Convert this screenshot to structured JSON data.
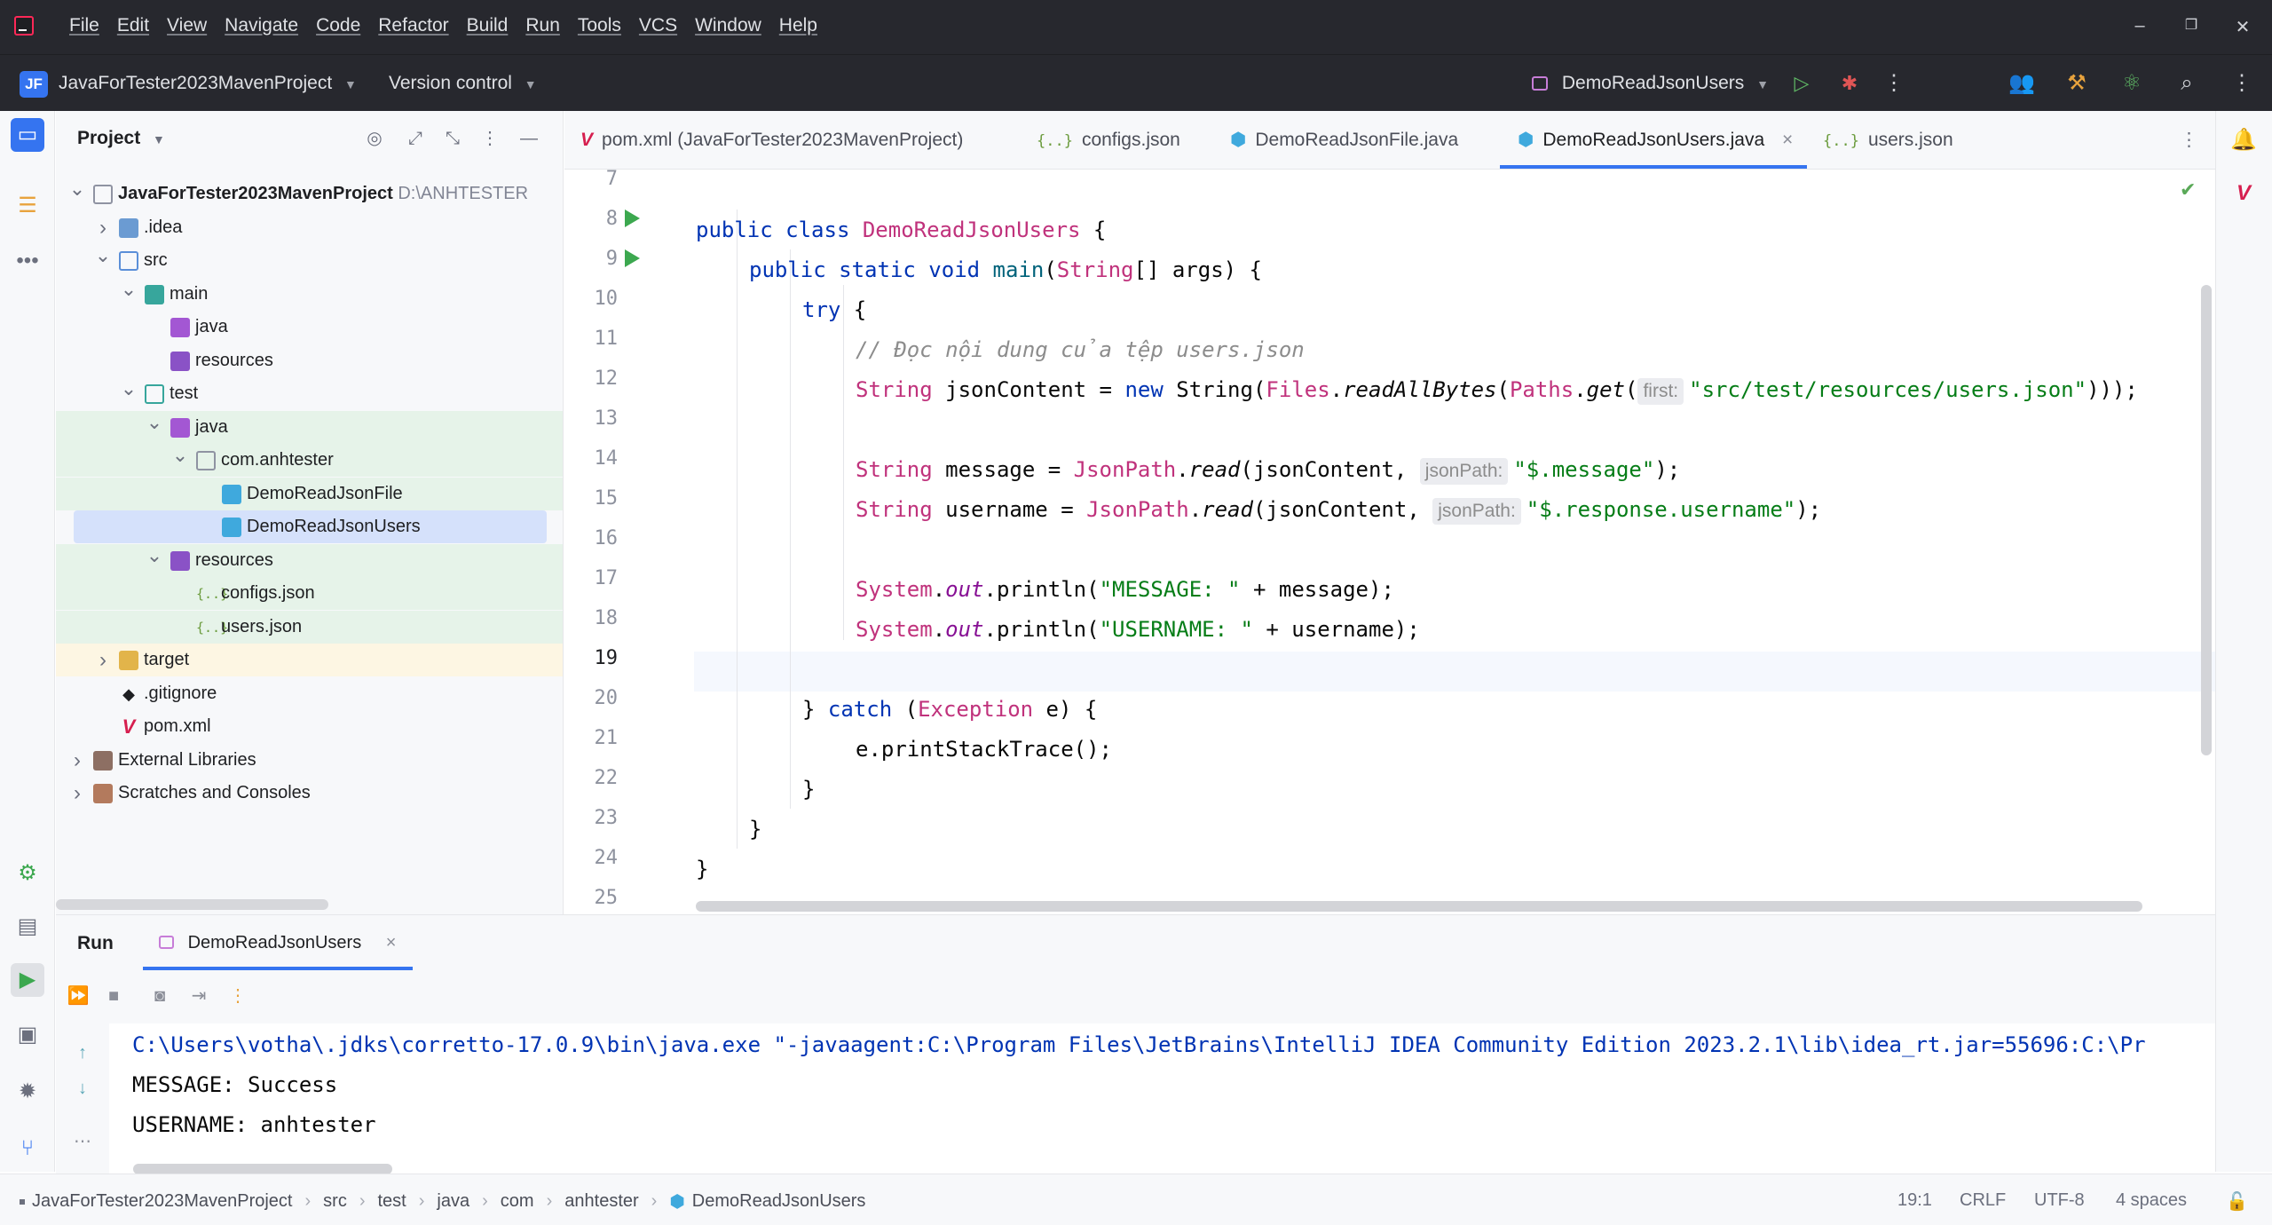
{
  "menu": [
    "File",
    "Edit",
    "View",
    "Navigate",
    "Code",
    "Refactor",
    "Build",
    "Run",
    "Tools",
    "VCS",
    "Window",
    "Help"
  ],
  "window_controls": {
    "minimize": "–",
    "restore": "❐",
    "close": "✕"
  },
  "toolbar": {
    "project_badge": "JF",
    "project_name": "JavaForTester2023MavenProject",
    "vcs_label": "Version control",
    "run_config": "DemoReadJsonUsers"
  },
  "icons": {
    "run": "play-icon",
    "debug": "bug-icon",
    "more": "more-vertical-icon",
    "collab": "people-icon",
    "build": "hammer-icon",
    "ai": "atom-icon",
    "search": "search-icon",
    "settings": "gear-icon"
  },
  "colors": {
    "accent": "#3574f0",
    "keyword": "#0033b3",
    "string": "#067d17",
    "class": "#c0327c",
    "run_green": "#3ca84f",
    "header_bg": "#27282e"
  },
  "project_panel": {
    "title": "Project",
    "tree": [
      {
        "label": "JavaForTester2023MavenProject",
        "extra": "D:\\ANHTESTER",
        "depth": 0,
        "chev": "open",
        "icon": "folder",
        "bold": true
      },
      {
        "label": ".idea",
        "depth": 1,
        "chev": "closed",
        "icon": "folder-blue"
      },
      {
        "label": "src",
        "depth": 1,
        "chev": "open",
        "icon": "src"
      },
      {
        "label": "main",
        "depth": 2,
        "chev": "open",
        "icon": "test"
      },
      {
        "label": "java",
        "depth": 3,
        "chev": "",
        "icon": "java"
      },
      {
        "label": "resources",
        "depth": 3,
        "chev": "",
        "icon": "res"
      },
      {
        "label": "test",
        "depth": 2,
        "chev": "open",
        "icon": "testsrc"
      },
      {
        "label": "java",
        "depth": 3,
        "chev": "open",
        "icon": "java",
        "hl": "green"
      },
      {
        "label": "com.anhtester",
        "depth": 4,
        "chev": "open",
        "icon": "folder",
        "hl": "green"
      },
      {
        "label": "DemoReadJsonFile",
        "depth": 5,
        "chev": "",
        "icon": "class",
        "hl": "green"
      },
      {
        "label": "DemoReadJsonUsers",
        "depth": 5,
        "chev": "",
        "icon": "class",
        "hl": "selected"
      },
      {
        "label": "resources",
        "depth": 3,
        "chev": "open",
        "icon": "res",
        "hl": "green"
      },
      {
        "label": "configs.json",
        "depth": 4,
        "chev": "",
        "icon": "json",
        "hl": "green"
      },
      {
        "label": "users.json",
        "depth": 4,
        "chev": "",
        "icon": "json",
        "hl": "green"
      },
      {
        "label": "target",
        "depth": 1,
        "chev": "closed",
        "icon": "target",
        "hl": "yellow"
      },
      {
        "label": ".gitignore",
        "depth": 1,
        "chev": "",
        "icon": "git"
      },
      {
        "label": "pom.xml",
        "depth": 1,
        "chev": "",
        "icon": "maven"
      },
      {
        "label": "External Libraries",
        "depth": 0,
        "chev": "closed",
        "icon": "lib"
      },
      {
        "label": "Scratches and Consoles",
        "depth": 0,
        "chev": "closed",
        "icon": "scratch"
      }
    ]
  },
  "editor": {
    "tabs": [
      {
        "label": "pom.xml (JavaForTester2023MavenProject)",
        "icon": "maven-icon"
      },
      {
        "label": "configs.json",
        "icon": "json-icon"
      },
      {
        "label": "DemoReadJsonFile.java",
        "icon": "class-icon"
      },
      {
        "label": "DemoReadJsonUsers.java",
        "icon": "class-icon",
        "active": true,
        "close": "×"
      },
      {
        "label": "users.json",
        "icon": "json-icon"
      }
    ],
    "line_numbers": [
      "7",
      "8",
      "9",
      "10",
      "11",
      "12",
      "13",
      "14",
      "15",
      "16",
      "17",
      "18",
      "19",
      "20",
      "21",
      "22",
      "23",
      "24",
      "25"
    ],
    "hints": {
      "first": "first:",
      "json_path": "jsonPath:"
    },
    "code": {
      "l8": [
        "public class ",
        "DemoReadJsonUsers",
        " {"
      ],
      "l9": [
        "public static void ",
        "main",
        "(",
        "String",
        "[] args) {"
      ],
      "l10": [
        "try",
        " {"
      ],
      "l11": "// Đọc nội dung của tệp users.json",
      "l12": [
        "String",
        " jsonContent = ",
        "new",
        " String(",
        "Files",
        ".",
        "readAllBytes",
        "(",
        "Paths",
        ".",
        "get",
        "(",
        "\"src/test/resources/users.json\"",
        ")));"
      ],
      "l14": [
        "String",
        " message = ",
        "JsonPath",
        ".",
        "read",
        "(jsonContent, ",
        "\"$.message\"",
        ");"
      ],
      "l15": [
        "String",
        " username = ",
        "JsonPath",
        ".",
        "read",
        "(jsonContent, ",
        "\"$.response.username\"",
        ");"
      ],
      "l17": [
        "System",
        ".",
        "out",
        ".println(",
        "\"MESSAGE: \"",
        " + message);"
      ],
      "l18": [
        "System",
        ".",
        "out",
        ".println(",
        "\"USERNAME: \"",
        " + username);"
      ],
      "l20": [
        "} ",
        "catch",
        " (",
        "Exception",
        " e) {"
      ],
      "l21": "e.printStackTrace();",
      "l22": "}",
      "l23": "}",
      "l24": "}"
    }
  },
  "run_panel": {
    "title": "Run",
    "tab_label": "DemoReadJsonUsers",
    "tab_close": "×",
    "console": [
      "C:\\Users\\votha\\.jdks\\corretto-17.0.9\\bin\\java.exe \"-javaagent:C:\\Program Files\\JetBrains\\IntelliJ IDEA Community Edition 2023.2.1\\lib\\idea_rt.jar=55696:C:\\Pr",
      "MESSAGE: Success",
      "USERNAME: anhtester"
    ]
  },
  "status_bar": {
    "breadcrumbs": [
      "JavaForTester2023MavenProject",
      "src",
      "test",
      "java",
      "com",
      "anhtester",
      "DemoReadJsonUsers"
    ],
    "position": "19:1",
    "line_ending": "CRLF",
    "encoding": "UTF-8",
    "indent": "4 spaces"
  }
}
